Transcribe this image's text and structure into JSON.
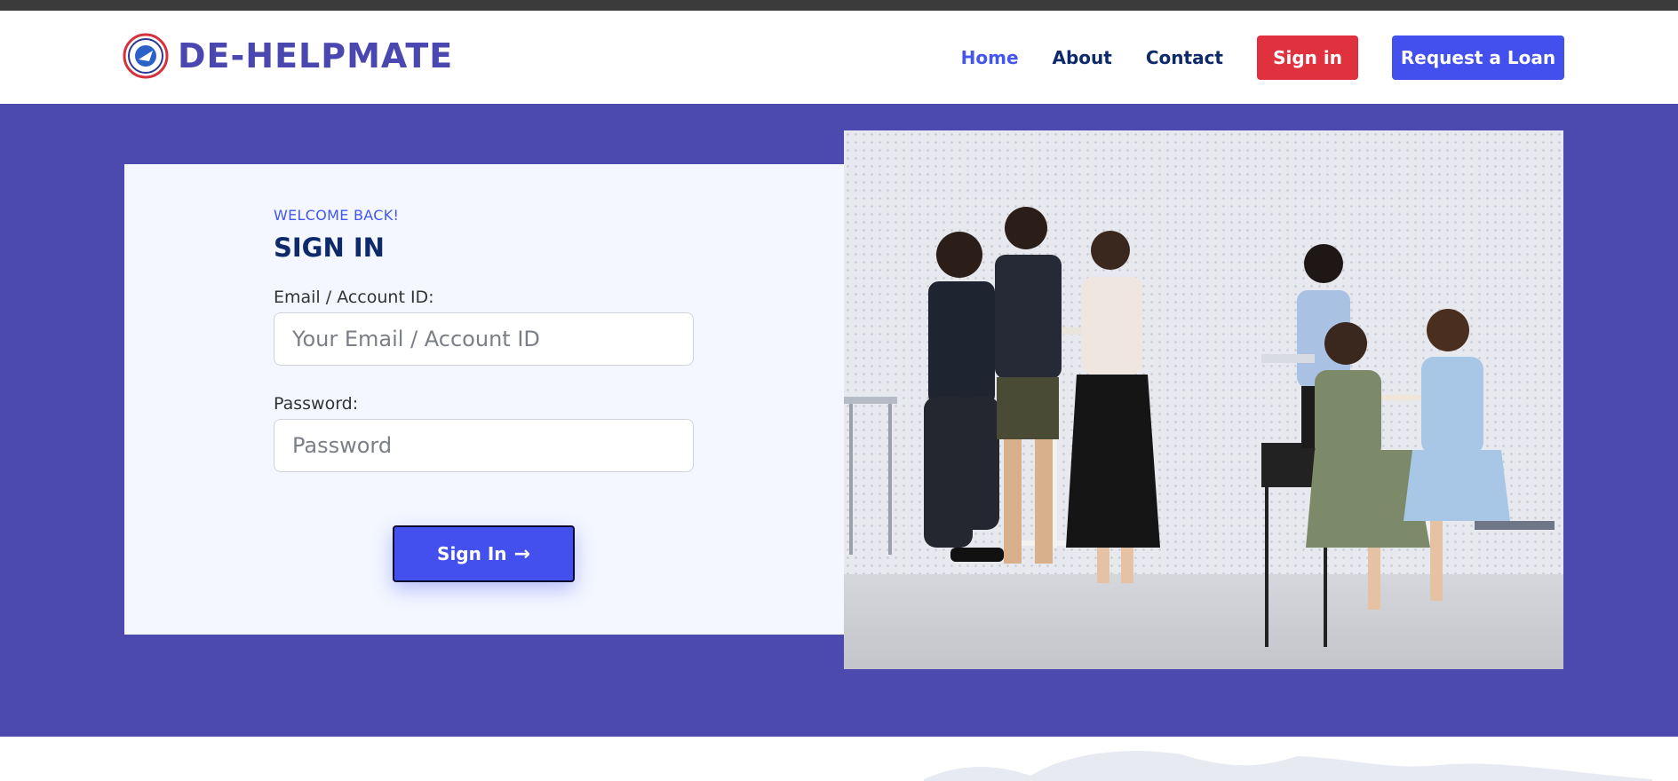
{
  "brand": {
    "name": "DE-HELPMATE"
  },
  "nav": {
    "links": [
      {
        "label": "Home",
        "active": true
      },
      {
        "label": "About",
        "active": false
      },
      {
        "label": "Contact",
        "active": false
      }
    ],
    "signin_label": "Sign in",
    "loan_label": "Request a Loan"
  },
  "login": {
    "eyebrow": "WELCOME BACK!",
    "title": "SIGN IN",
    "email_label": "Email / Account ID:",
    "email_placeholder": "Your Email / Account ID",
    "password_label": "Password:",
    "password_placeholder": "Password",
    "submit_label": "Sign In"
  },
  "colors": {
    "hero_bg": "#4c4aae",
    "primary": "#4350ee",
    "danger": "#e0313f",
    "nav_text": "#0f2a6b"
  }
}
